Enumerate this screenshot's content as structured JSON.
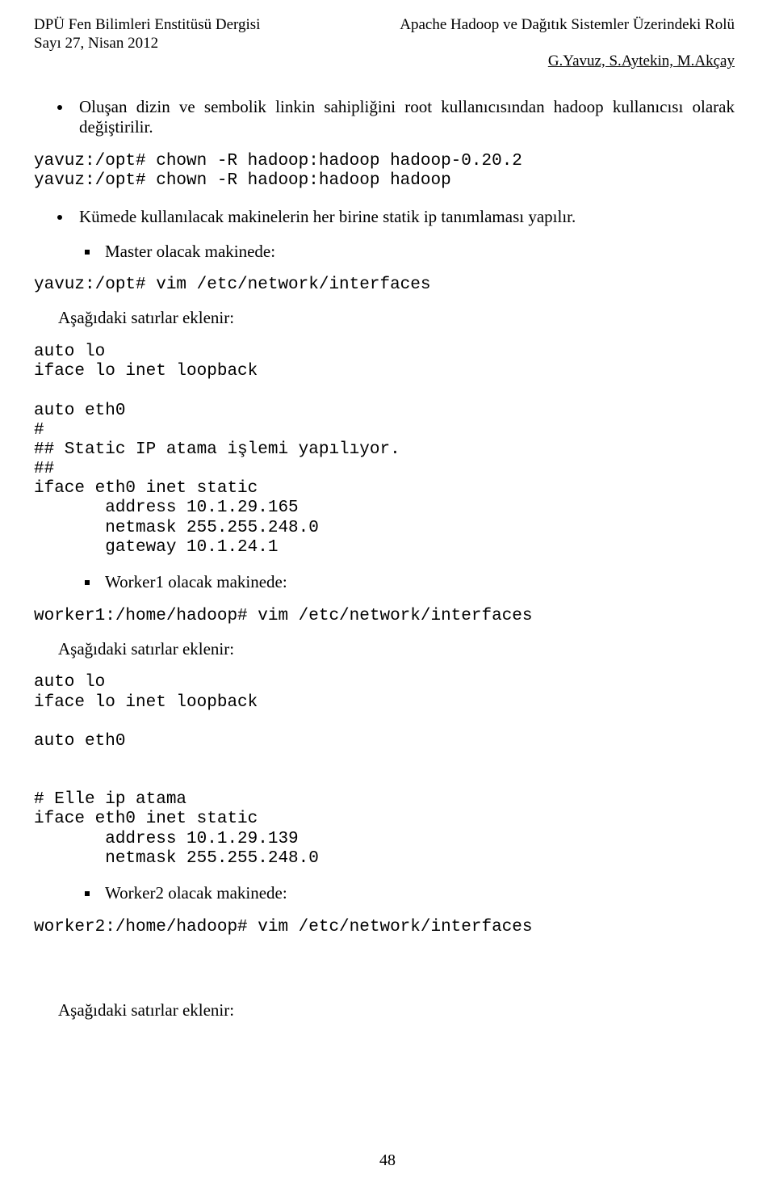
{
  "header": {
    "left_line1": "DPÜ Fen Bilimleri Enstitüsü Dergisi",
    "left_line2": "Sayı 27, Nisan 2012",
    "right_line1": "Apache Hadoop ve Dağıtık Sistemler Üzerindeki Rolü",
    "right_line2": "G.Yavuz, S.Aytekin, M.Akçay"
  },
  "bullets": {
    "b1": "Oluşan dizin ve sembolik linkin sahipliğini root kullanıcısından hadoop kullanıcısı olarak değiştirilir.",
    "b2": "Kümede kullanılacak makinelerin her birine statik ip tanımlaması yapılır."
  },
  "code": {
    "chown": "yavuz:/opt# chown -R hadoop:hadoop hadoop-0.20.2\nyavuz:/opt# chown -R hadoop:hadoop hadoop",
    "master_cmd": "yavuz:/opt# vim /etc/network/interfaces",
    "master_block": "auto lo\niface lo inet loopback\n\nauto eth0\n#\n## Static IP atama işlemi yapılıyor.\n##\niface eth0 inet static\n       address 10.1.29.165\n       netmask 255.255.248.0\n       gateway 10.1.24.1",
    "worker1_cmd": "worker1:/home/hadoop# vim /etc/network/interfaces",
    "worker1_block": "auto lo\niface lo inet loopback\n\nauto eth0\n\n\n# Elle ip atama\niface eth0 inet static\n       address 10.1.29.139\n       netmask 255.255.248.0",
    "worker2_cmd": "worker2:/home/hadoop# vim /etc/network/interfaces"
  },
  "squares": {
    "master": "Master olacak makinede:",
    "worker1": "Worker1 olacak makinede:",
    "worker2": "Worker2 olacak makinede:"
  },
  "labels": {
    "lines_added": "Aşağıdaki satırlar eklenir:"
  },
  "page_number": "48"
}
